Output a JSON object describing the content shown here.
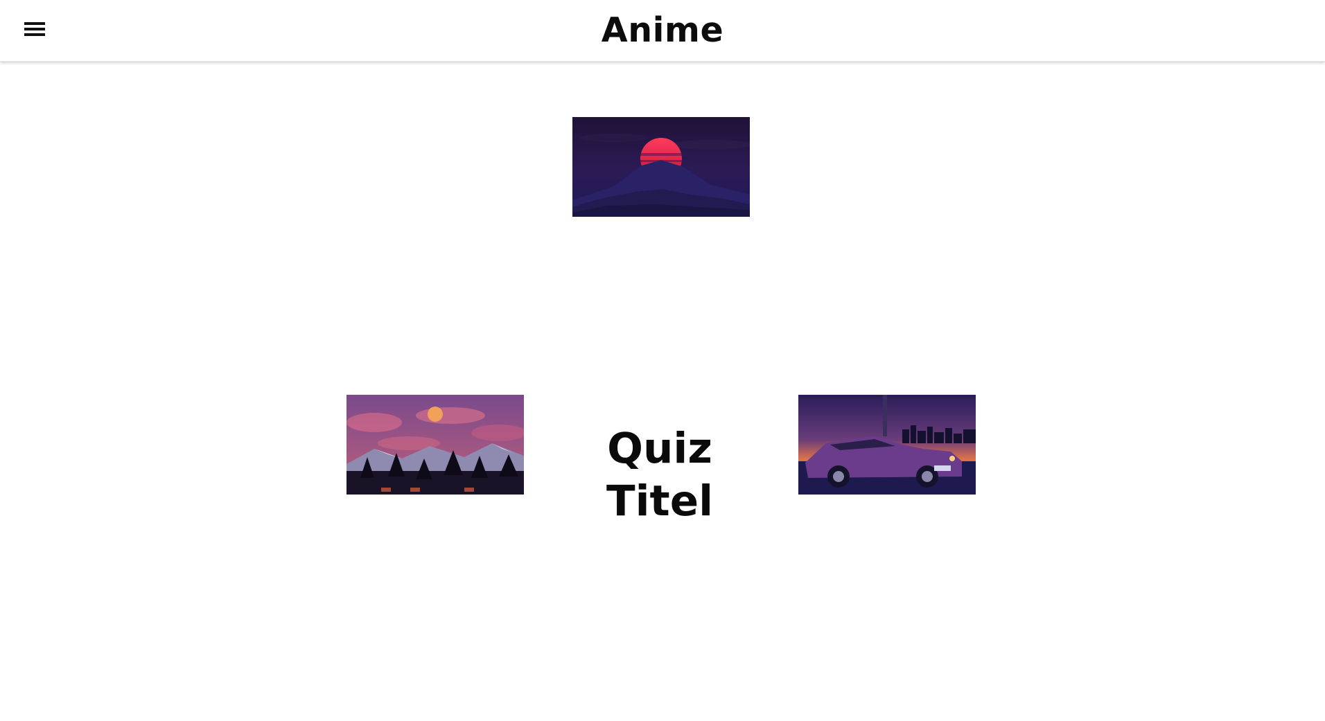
{
  "header": {
    "title": "Anime",
    "menu_icon": "hamburger-menu-icon"
  },
  "main": {
    "quiz_title": "Quiz Titel",
    "images": [
      {
        "name": "sunset-mountains-image",
        "description_icon": "image"
      },
      {
        "name": "moon-forest-image",
        "description_icon": "image"
      },
      {
        "name": "retro-car-image",
        "description_icon": "image"
      }
    ]
  },
  "colors": {
    "header_bg": "#ffffff",
    "text": "#0a0a0a",
    "page_bg": "#ffffff"
  }
}
